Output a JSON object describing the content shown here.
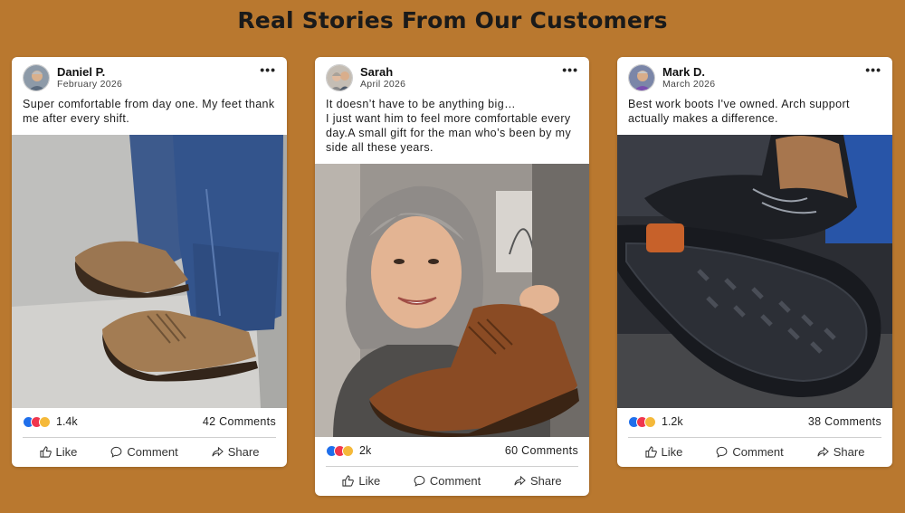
{
  "heading": "Real Stories From Our Customers",
  "posts": [
    {
      "name": "Daniel P.",
      "date": "February 2026",
      "text": "Super comfortable from day one. My feet thank me after every shift.",
      "reactions": "1.4k",
      "comments": "42 Comments",
      "photo_subject": "tan-leather-shoes-with-jeans",
      "actions": {
        "like": "Like",
        "comment": "Comment",
        "share": "Share"
      }
    },
    {
      "name": "Sarah",
      "date": "April 2026",
      "text": "It doesn’t have to be anything big…\nI just want him to feel more comfortable every day.A small gift for the man who’s been by my side all these years.",
      "reactions": "2k",
      "comments": "60 Comments",
      "photo_subject": "woman-holding-brown-boot",
      "actions": {
        "like": "Like",
        "comment": "Comment",
        "share": "Share"
      }
    },
    {
      "name": "Mark D.",
      "date": "March 2026",
      "text": "Best work boots I've owned. Arch support actually makes a difference.",
      "reactions": "1.2k",
      "comments": "38 Comments",
      "photo_subject": "black-work-boots-soles",
      "actions": {
        "like": "Like",
        "comment": "Comment",
        "share": "Share"
      }
    }
  ],
  "colors": {
    "background": "#b9782f",
    "like": "#1f6feb",
    "love": "#f0364e",
    "haha": "#f5b93a"
  }
}
